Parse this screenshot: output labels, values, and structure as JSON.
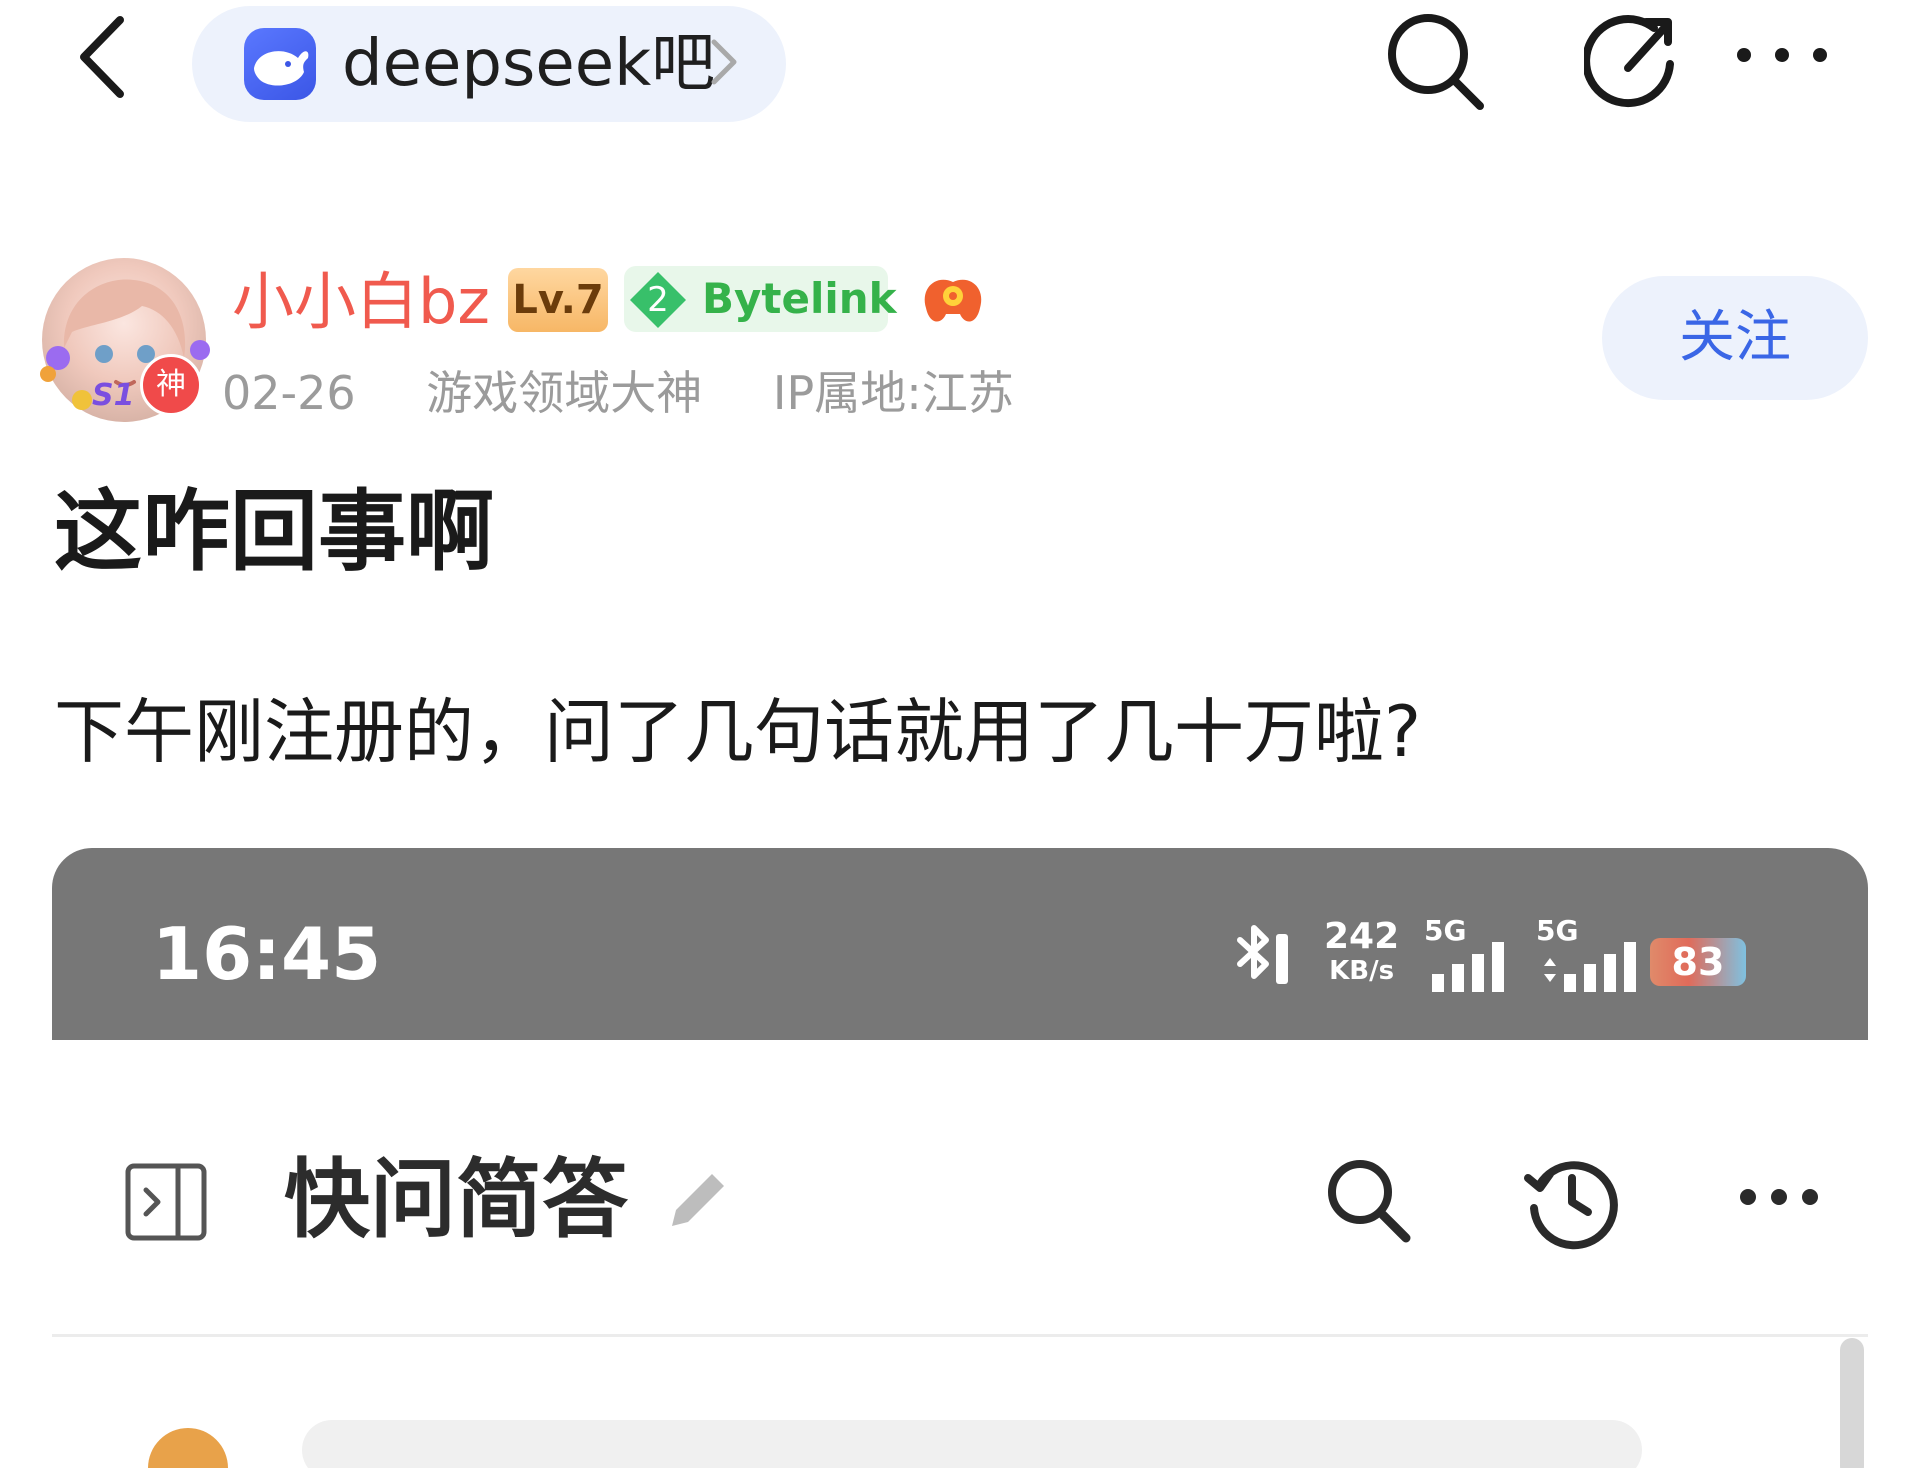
{
  "nav": {
    "forum_name": "deepseek吧",
    "icons": [
      "back-arrow-icon",
      "deepseek-whale-logo-icon",
      "chevron-right-icon",
      "search-icon",
      "share-icon",
      "more-horizontal-icon"
    ]
  },
  "author": {
    "name": "小小白bz",
    "level": "Lv.7",
    "avatar_badge": "神",
    "avatar_tag": "S1",
    "bytelink_level": "2",
    "bytelink_label": "Bytelink",
    "date": "02-26",
    "title_tag": "游戏领域大神",
    "ip_location": "IP属地:江苏",
    "follow_label": "关注",
    "colors": {
      "name": "#f05a4e",
      "follow_text": "#3a66e6",
      "bytelink": "#35b24a"
    }
  },
  "post": {
    "title": "这咋回事啊",
    "body": "下午刚注册的，问了几句话就用了几十万啦?"
  },
  "embedded_screenshot": {
    "status_bar": {
      "time": "16:45",
      "net_speed_value": "242",
      "net_speed_unit": "KB/s",
      "signal_1_label": "5G",
      "signal_2_label": "5G",
      "battery": "83"
    },
    "app_bar": {
      "title": "快问简答",
      "icons": [
        "sidebar-toggle-icon",
        "edit-pencil-icon",
        "search-icon",
        "history-icon",
        "more-horizontal-icon"
      ]
    }
  }
}
